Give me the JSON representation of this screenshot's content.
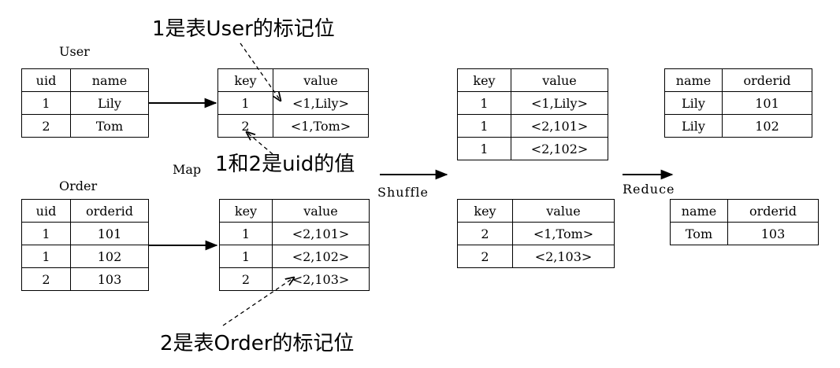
{
  "colors": {
    "ink": "#000000",
    "background": "#ffffff"
  },
  "annotations": {
    "user_flag": "1是表User的标记位",
    "uid_value": "1和2是uid的值",
    "order_flag": "2是表Order的标记位"
  },
  "stages": {
    "map": "Map",
    "shuffle": "Shuffle",
    "reduce": "Reduce"
  },
  "user_table": {
    "title": "User",
    "headers": [
      "uid",
      "name"
    ],
    "rows": [
      [
        "1",
        "Lily"
      ],
      [
        "2",
        "Tom"
      ]
    ]
  },
  "order_table": {
    "title": "Order",
    "headers": [
      "uid",
      "orderid"
    ],
    "rows": [
      [
        "1",
        "101"
      ],
      [
        "1",
        "102"
      ],
      [
        "2",
        "103"
      ]
    ]
  },
  "map_user_table": {
    "headers": [
      "key",
      "value"
    ],
    "rows": [
      [
        "1",
        "<1,Lily>"
      ],
      [
        "2",
        "<1,Tom>"
      ]
    ]
  },
  "map_order_table": {
    "headers": [
      "key",
      "value"
    ],
    "rows": [
      [
        "1",
        "<2,101>"
      ],
      [
        "1",
        "<2,102>"
      ],
      [
        "2",
        "<2,103>"
      ]
    ]
  },
  "shuffle_key1_table": {
    "headers": [
      "key",
      "value"
    ],
    "rows": [
      [
        "1",
        "<1,Lily>"
      ],
      [
        "1",
        "<2,101>"
      ],
      [
        "1",
        "<2,102>"
      ]
    ]
  },
  "shuffle_key2_table": {
    "headers": [
      "key",
      "value"
    ],
    "rows": [
      [
        "2",
        "<1,Tom>"
      ],
      [
        "2",
        "<2,103>"
      ]
    ]
  },
  "reduce_key1_table": {
    "headers": [
      "name",
      "orderid"
    ],
    "rows": [
      [
        "Lily",
        "101"
      ],
      [
        "Lily",
        "102"
      ]
    ]
  },
  "reduce_key2_table": {
    "headers": [
      "name",
      "orderid"
    ],
    "rows": [
      [
        "Tom",
        "103"
      ]
    ]
  }
}
